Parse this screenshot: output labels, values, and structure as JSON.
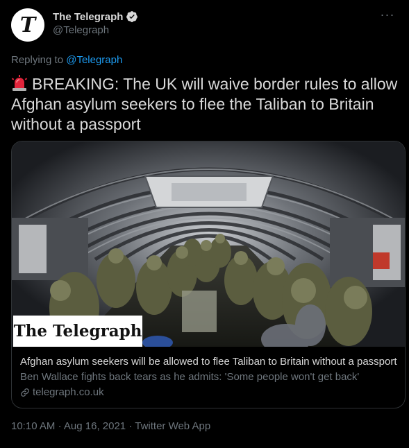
{
  "account": {
    "display_name": "The Telegraph",
    "handle": "@Telegraph",
    "avatar_letter": "T",
    "verified": true,
    "verified_icon": "verified-badge-icon",
    "more_icon": "more-options-icon",
    "more_label": "···"
  },
  "reply": {
    "prefix": "Replying to ",
    "mention": "@Telegraph"
  },
  "tweet": {
    "emoji_icon": "police-siren-icon",
    "text": "BREAKING: The UK will waive border rules to allow Afghan asylum seekers to flee the Taliban to Britain without a passport"
  },
  "card": {
    "image_logo_text": "The Telegraph",
    "title": "Afghan asylum seekers will be allowed to flee Taliban to Britain without a passport",
    "description": "Ben Wallace fights back tears as he admits: 'Some people won't get back'",
    "link_icon": "link-icon",
    "domain": "telegraph.co.uk"
  },
  "meta": {
    "time": "10:10 AM",
    "separator": "·",
    "date": "Aug 16, 2021",
    "source": "Twitter Web App"
  },
  "colors": {
    "background": "#000000",
    "text": "#d9d9d9",
    "secondary": "#6e767d",
    "accent": "#1d9bf0",
    "border": "#2f3336"
  }
}
